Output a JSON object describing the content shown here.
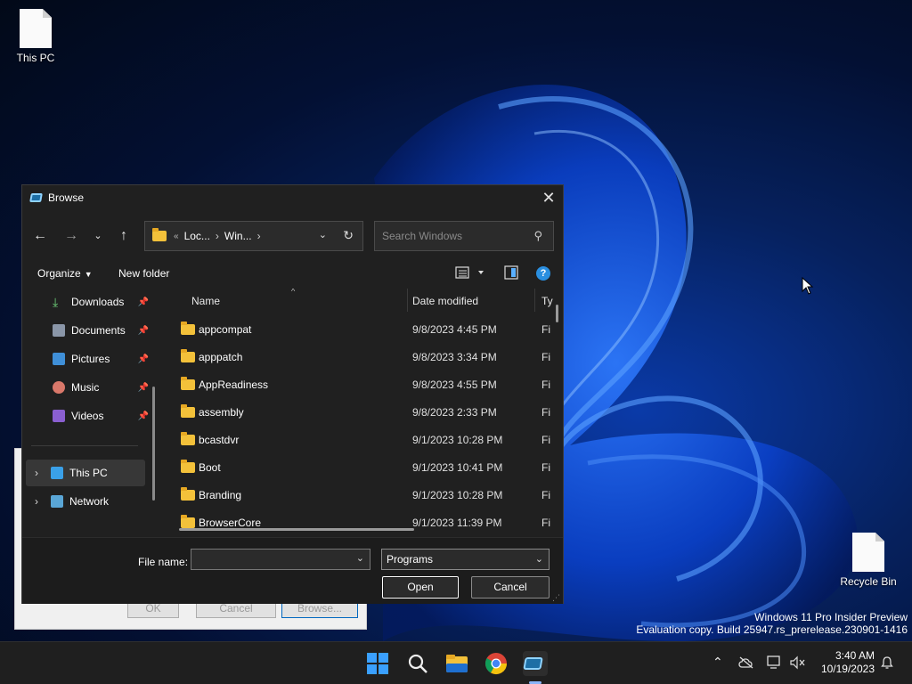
{
  "desktop": {
    "icons": [
      {
        "label": "This PC"
      },
      {
        "label": "Recycle Bin"
      }
    ],
    "watermark": {
      "line1": "Windows 11 Pro Insider Preview",
      "line2": "Evaluation copy. Build 25947.rs_prerelease.230901-1416"
    }
  },
  "underlying_dialog": {
    "buttons": [
      "OK",
      "Cancel",
      "Browse..."
    ]
  },
  "dialog": {
    "title": "Browse",
    "close_label": "✕",
    "address": {
      "overflow": "«",
      "segments": [
        "Loc...",
        "Win..."
      ]
    },
    "search_placeholder": "Search Windows",
    "toolbar": {
      "organize_label": "Organize",
      "new_folder_label": "New folder",
      "help_label": "?"
    },
    "nav_pane": {
      "quick_access": [
        {
          "label": "Downloads",
          "icon": "downloads-icon"
        },
        {
          "label": "Documents",
          "icon": "documents-icon"
        },
        {
          "label": "Pictures",
          "icon": "pictures-icon"
        },
        {
          "label": "Music",
          "icon": "music-icon"
        },
        {
          "label": "Videos",
          "icon": "videos-icon"
        }
      ],
      "locations": [
        {
          "label": "This PC",
          "icon": "this-pc-icon",
          "selected": true
        },
        {
          "label": "Network",
          "icon": "network-icon",
          "selected": false
        }
      ]
    },
    "columns": {
      "name": "Name",
      "date_modified": "Date modified",
      "type": "Ty"
    },
    "files": [
      {
        "name": "appcompat",
        "date": "9/8/2023 4:45 PM",
        "type": "Fi"
      },
      {
        "name": "apppatch",
        "date": "9/8/2023 3:34 PM",
        "type": "Fi"
      },
      {
        "name": "AppReadiness",
        "date": "9/8/2023 4:55 PM",
        "type": "Fi"
      },
      {
        "name": "assembly",
        "date": "9/8/2023 2:33 PM",
        "type": "Fi"
      },
      {
        "name": "bcastdvr",
        "date": "9/1/2023 10:28 PM",
        "type": "Fi"
      },
      {
        "name": "Boot",
        "date": "9/1/2023 10:41 PM",
        "type": "Fi"
      },
      {
        "name": "Branding",
        "date": "9/1/2023 10:28 PM",
        "type": "Fi"
      },
      {
        "name": "BrowserCore",
        "date": "9/1/2023 11:39 PM",
        "type": "Fi"
      }
    ],
    "footer": {
      "file_name_label": "File name:",
      "file_name_value": "",
      "file_type_value": "Programs",
      "open_label": "Open",
      "cancel_label": "Cancel"
    }
  },
  "taskbar": {
    "clock_time": "3:40 AM",
    "clock_date": "10/19/2023"
  },
  "colors": {
    "accent": "#2a8fe0",
    "folder": "#f3c13a",
    "dialog_bg": "#202020"
  }
}
